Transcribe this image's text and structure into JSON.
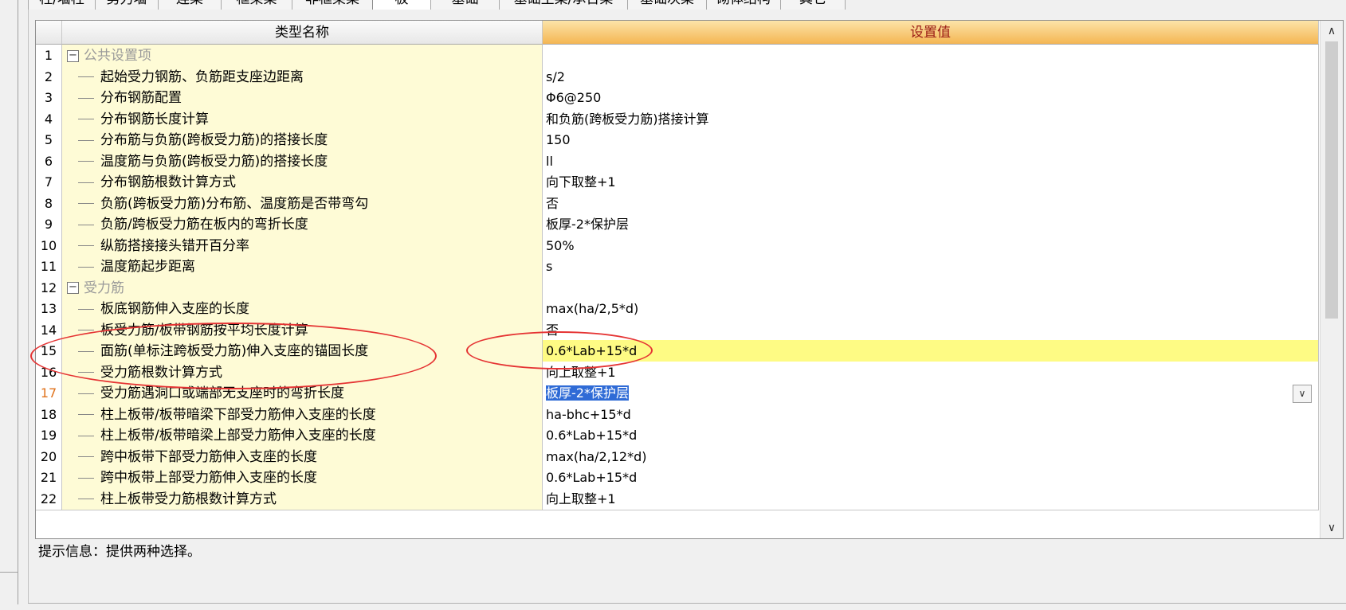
{
  "tabs": [
    "柱/墙柱",
    "剪力墙",
    "连梁",
    "框架梁",
    "非框架梁",
    "板",
    "基础",
    "基础主梁/承台梁",
    "基础次梁",
    "砌体结构",
    "其它"
  ],
  "grid": {
    "header": {
      "name": "类型名称",
      "value": "设置值"
    },
    "rows": [
      {
        "num": "1",
        "name": "公共设置项",
        "value": "",
        "group": true
      },
      {
        "num": "2",
        "name": "起始受力钢筋、负筋距支座边距离",
        "value": "s/2"
      },
      {
        "num": "3",
        "name": "分布钢筋配置",
        "value": "Φ6@250"
      },
      {
        "num": "4",
        "name": "分布钢筋长度计算",
        "value": "和负筋(跨板受力筋)搭接计算"
      },
      {
        "num": "5",
        "name": "分布筋与负筋(跨板受力筋)的搭接长度",
        "value": "150"
      },
      {
        "num": "6",
        "name": "温度筋与负筋(跨板受力筋)的搭接长度",
        "value": "ll"
      },
      {
        "num": "7",
        "name": "分布钢筋根数计算方式",
        "value": "向下取整+1"
      },
      {
        "num": "8",
        "name": "负筋(跨板受力筋)分布筋、温度筋是否带弯勾",
        "value": "否"
      },
      {
        "num": "9",
        "name": "负筋/跨板受力筋在板内的弯折长度",
        "value": "板厚-2*保护层"
      },
      {
        "num": "10",
        "name": "纵筋搭接接头错开百分率",
        "value": "50%"
      },
      {
        "num": "11",
        "name": "温度筋起步距离",
        "value": "s"
      },
      {
        "num": "12",
        "name": "受力筋",
        "value": "",
        "group": true
      },
      {
        "num": "13",
        "name": "板底钢筋伸入支座的长度",
        "value": "max(ha/2,5*d)"
      },
      {
        "num": "14",
        "name": "板受力筋/板带钢筋按平均长度计算",
        "value": "否"
      },
      {
        "num": "15",
        "name": "面筋(单标注跨板受力筋)伸入支座的锚固长度",
        "value": "0.6*Lab+15*d",
        "highlight": true
      },
      {
        "num": "16",
        "name": "受力筋根数计算方式",
        "value": "向上取整+1"
      },
      {
        "num": "17",
        "name": "受力筋遇洞口或端部无支座时的弯折长度",
        "value": "板厚-2*保护层",
        "active": true
      },
      {
        "num": "18",
        "name": "柱上板带/板带暗梁下部受力筋伸入支座的长度",
        "value": "ha-bhc+15*d"
      },
      {
        "num": "19",
        "name": "柱上板带/板带暗梁上部受力筋伸入支座的长度",
        "value": "0.6*Lab+15*d"
      },
      {
        "num": "20",
        "name": "跨中板带下部受力筋伸入支座的长度",
        "value": "max(ha/2,12*d)"
      },
      {
        "num": "21",
        "name": "跨中板带上部受力筋伸入支座的长度",
        "value": "0.6*Lab+15*d"
      },
      {
        "num": "22",
        "name": "柱上板带受力筋根数计算方式",
        "value": "向上取整+1"
      }
    ]
  },
  "hint": "提示信息：提供两种选择。",
  "icons": {
    "collapse": "minus-box-icon",
    "dropdown": "chevron-down-icon",
    "scroll_up": "chevron-up-icon",
    "scroll_down": "chevron-down-icon"
  },
  "colors": {
    "header_value_bg": "#f4b653",
    "name_col_bg": "#fefbd6",
    "highlight_bg": "#fefb84",
    "selection": "#2f6bd6",
    "annotation": "#e53333"
  }
}
